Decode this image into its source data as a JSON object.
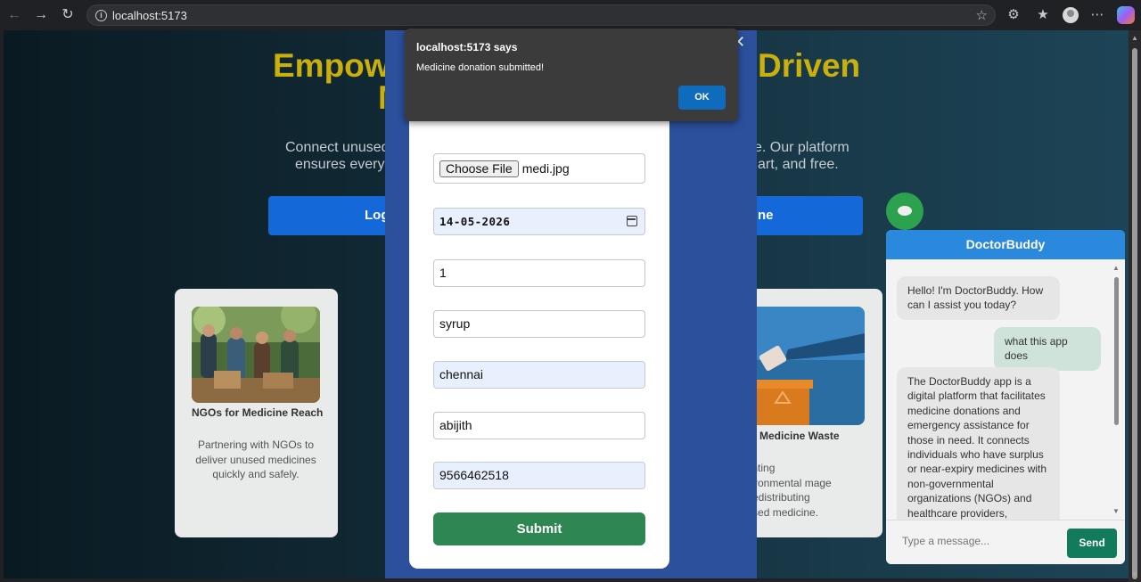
{
  "browser": {
    "url": "localhost:5173"
  },
  "hero": {
    "title_left": "Empow",
    "title_right": "Driven",
    "title_line2": "M",
    "subtitle_left_1": "Connect unused",
    "subtitle_left_2": "ensures every",
    "subtitle_right_1": "e. Our platform",
    "subtitle_right_2": "art, and free.",
    "button_left": "Log",
    "button_right": "ne"
  },
  "cards": [
    {
      "title": "NGOs for Medicine Reach",
      "description": "Partnering with NGOs to deliver unused medicines quickly and safely."
    },
    {
      "title": "void Medicine Waste",
      "description": "eventing environmental mage by redistributing unused medicine."
    }
  ],
  "form": {
    "file_button": "Choose File",
    "file_name": "medi.jpg",
    "date": "14-05-2026",
    "quantity": "1",
    "medicine_type": "syrup",
    "city": "chennai",
    "name": "abijith",
    "phone": "9566462518",
    "submit_label": "Submit"
  },
  "alert": {
    "title": "localhost:5173 says",
    "message": "Medicine donation submitted!",
    "ok_label": "OK"
  },
  "chat": {
    "title": "DoctorBuddy",
    "messages": [
      {
        "from": "bot",
        "text": "Hello! I'm DoctorBuddy. How can I assist you today?"
      },
      {
        "from": "user",
        "text": "what this app does"
      },
      {
        "from": "bot",
        "text": "The DoctorBuddy app is a digital platform that facilitates medicine donations and emergency assistance for those in need. It connects individuals who have surplus or near-expiry medicines with non-governmental organizations (NGOs) and healthcare providers, ensuring"
      }
    ],
    "input_placeholder": "Type a message...",
    "send_label": "Send"
  }
}
